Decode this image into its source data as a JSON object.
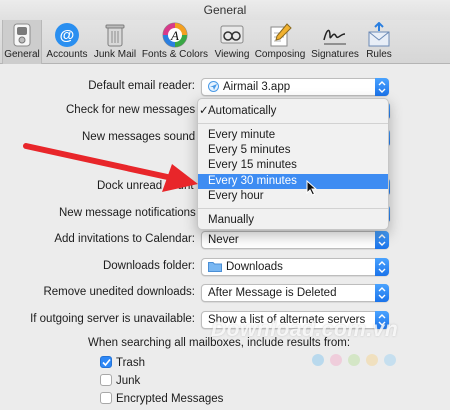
{
  "window": {
    "title": "General"
  },
  "toolbar": {
    "items": [
      {
        "label": "General",
        "icon": "switch-icon",
        "active": true
      },
      {
        "label": "Accounts",
        "icon": "at-sign-icon"
      },
      {
        "label": "Junk Mail",
        "icon": "trash-bin-icon"
      },
      {
        "label": "Fonts & Colors",
        "icon": "font-palette-icon"
      },
      {
        "label": "Viewing",
        "icon": "glasses-icon"
      },
      {
        "label": "Composing",
        "icon": "pencil-paper-icon"
      },
      {
        "label": "Signatures",
        "icon": "signature-icon"
      },
      {
        "label": "Rules",
        "icon": "rules-envelope-icon"
      }
    ]
  },
  "settings": {
    "default_email_reader": {
      "label": "Default email reader:",
      "value": "Airmail 3.app"
    },
    "check_new_messages": {
      "label": "Check for new messages"
    },
    "new_messages_sound": {
      "label": "New messages sound"
    },
    "dock_unread_count": {
      "label": "Dock unread count"
    },
    "new_message_notifications": {
      "label": "New message notifications"
    },
    "add_invitations": {
      "label": "Add invitations to Calendar:",
      "value": "Never"
    },
    "downloads_folder": {
      "label": "Downloads folder:",
      "value": "Downloads"
    },
    "remove_unedited": {
      "label": "Remove unedited downloads:",
      "value": "After Message is Deleted"
    },
    "outgoing_server": {
      "label": "If outgoing server is unavailable:",
      "value": "Show a list of alternate servers"
    },
    "search_mailboxes": {
      "label": "When searching all mailboxes, include results from:",
      "options": [
        {
          "label": "Trash",
          "checked": true
        },
        {
          "label": "Junk",
          "checked": false
        },
        {
          "label": "Encrypted Messages",
          "checked": false
        }
      ]
    }
  },
  "dropdown": {
    "items": {
      "automatically": "Automatically",
      "every_minute": "Every minute",
      "every_5_minutes": "Every 5 minutes",
      "every_15_minutes": "Every 15 minutes",
      "every_30_minutes": "Every 30 minutes",
      "every_hour": "Every hour",
      "manually": "Manually"
    },
    "checked_item": "Automatically",
    "highlighted_item": "Every 30 minutes"
  },
  "watermark": {
    "text": "Download.com.vn"
  },
  "colors": {
    "accent": "#3e8cf2",
    "arrow": "#e8262a",
    "window_bg": "#ececec"
  }
}
